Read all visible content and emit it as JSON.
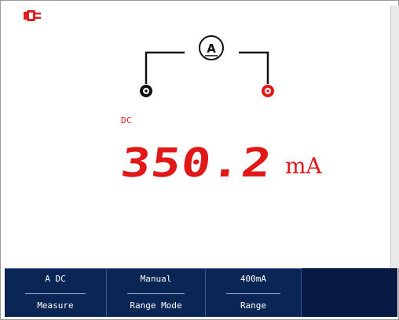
{
  "display": {
    "mode_label": "DC",
    "reading_value": "350.2",
    "reading_unit": "mA",
    "probe_symbol": "A",
    "colors": {
      "reading": "#e01818",
      "softkey_bg": "#0b2554",
      "com_terminal": "#111111",
      "input_terminal": "#e01818"
    }
  },
  "softkeys": [
    {
      "value": "A DC",
      "name": "Measure"
    },
    {
      "value": "Manual",
      "name": "Range Mode"
    },
    {
      "value": "400mA",
      "name": "Range"
    }
  ],
  "icons": {
    "power": "power-plug-icon",
    "meter": "ammeter-icon",
    "com_terminal": "com-terminal-icon",
    "input_terminal": "input-terminal-icon"
  }
}
